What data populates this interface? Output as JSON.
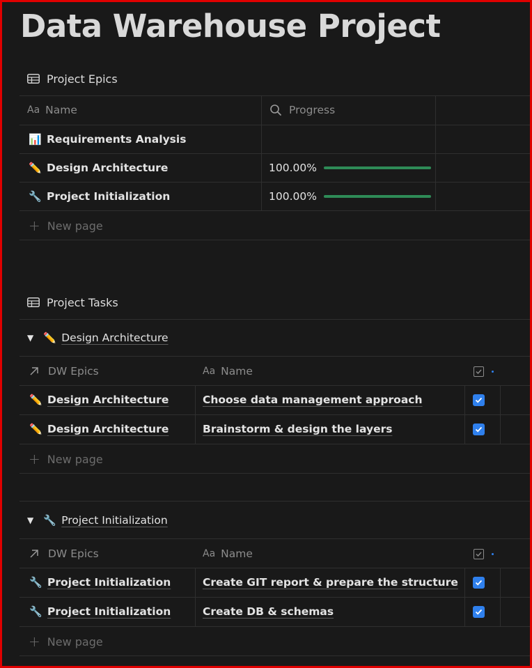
{
  "page": {
    "title": "Data Warehouse Project"
  },
  "epics": {
    "title": "Project Epics",
    "columns": {
      "name": "Name",
      "progress": "Progress"
    },
    "rows": [
      {
        "emoji": "📊",
        "name": "Requirements Analysis",
        "progress": "",
        "fraction": 0
      },
      {
        "emoji": "✏️",
        "name": "Design Architecture",
        "progress": "100.00%",
        "fraction": 1.0
      },
      {
        "emoji": "🔧",
        "name": "Project Initialization",
        "progress": "100.00%",
        "fraction": 1.0
      }
    ],
    "new_page": "New page"
  },
  "tasks": {
    "title": "Project Tasks",
    "columns": {
      "epic": "DW Epics",
      "name": "Name"
    },
    "groups": [
      {
        "emoji": "✏️",
        "label": "Design Architecture",
        "rows": [
          {
            "epic_emoji": "✏️",
            "epic": "Design Architecture",
            "name": "Choose data management approach",
            "done": true
          },
          {
            "epic_emoji": "✏️",
            "epic": "Design Architecture",
            "name": "Brainstorm & design the layers",
            "done": true
          }
        ],
        "new_page": "New page"
      },
      {
        "emoji": "🔧",
        "label": "Project Initialization",
        "rows": [
          {
            "epic_emoji": "🔧",
            "epic": "Project Initialization",
            "name": "Create GIT report & prepare the structure",
            "done": true
          },
          {
            "epic_emoji": "🔧",
            "epic": "Project Initialization",
            "name": "Create DB & schemas",
            "done": true
          }
        ],
        "new_page": "New page"
      }
    ]
  },
  "icons": {
    "table": "table-icon",
    "aa": "Aa",
    "search": "search-icon",
    "relation": "arrow-up-right-icon",
    "checkbox": "checkbox-icon",
    "toggle": "triangle-down-icon",
    "plus": "plus-icon"
  },
  "colors": {
    "background": "#191919",
    "progress": "#2e8b57",
    "checkbox": "#2f80ed",
    "frame": "#e00000"
  }
}
